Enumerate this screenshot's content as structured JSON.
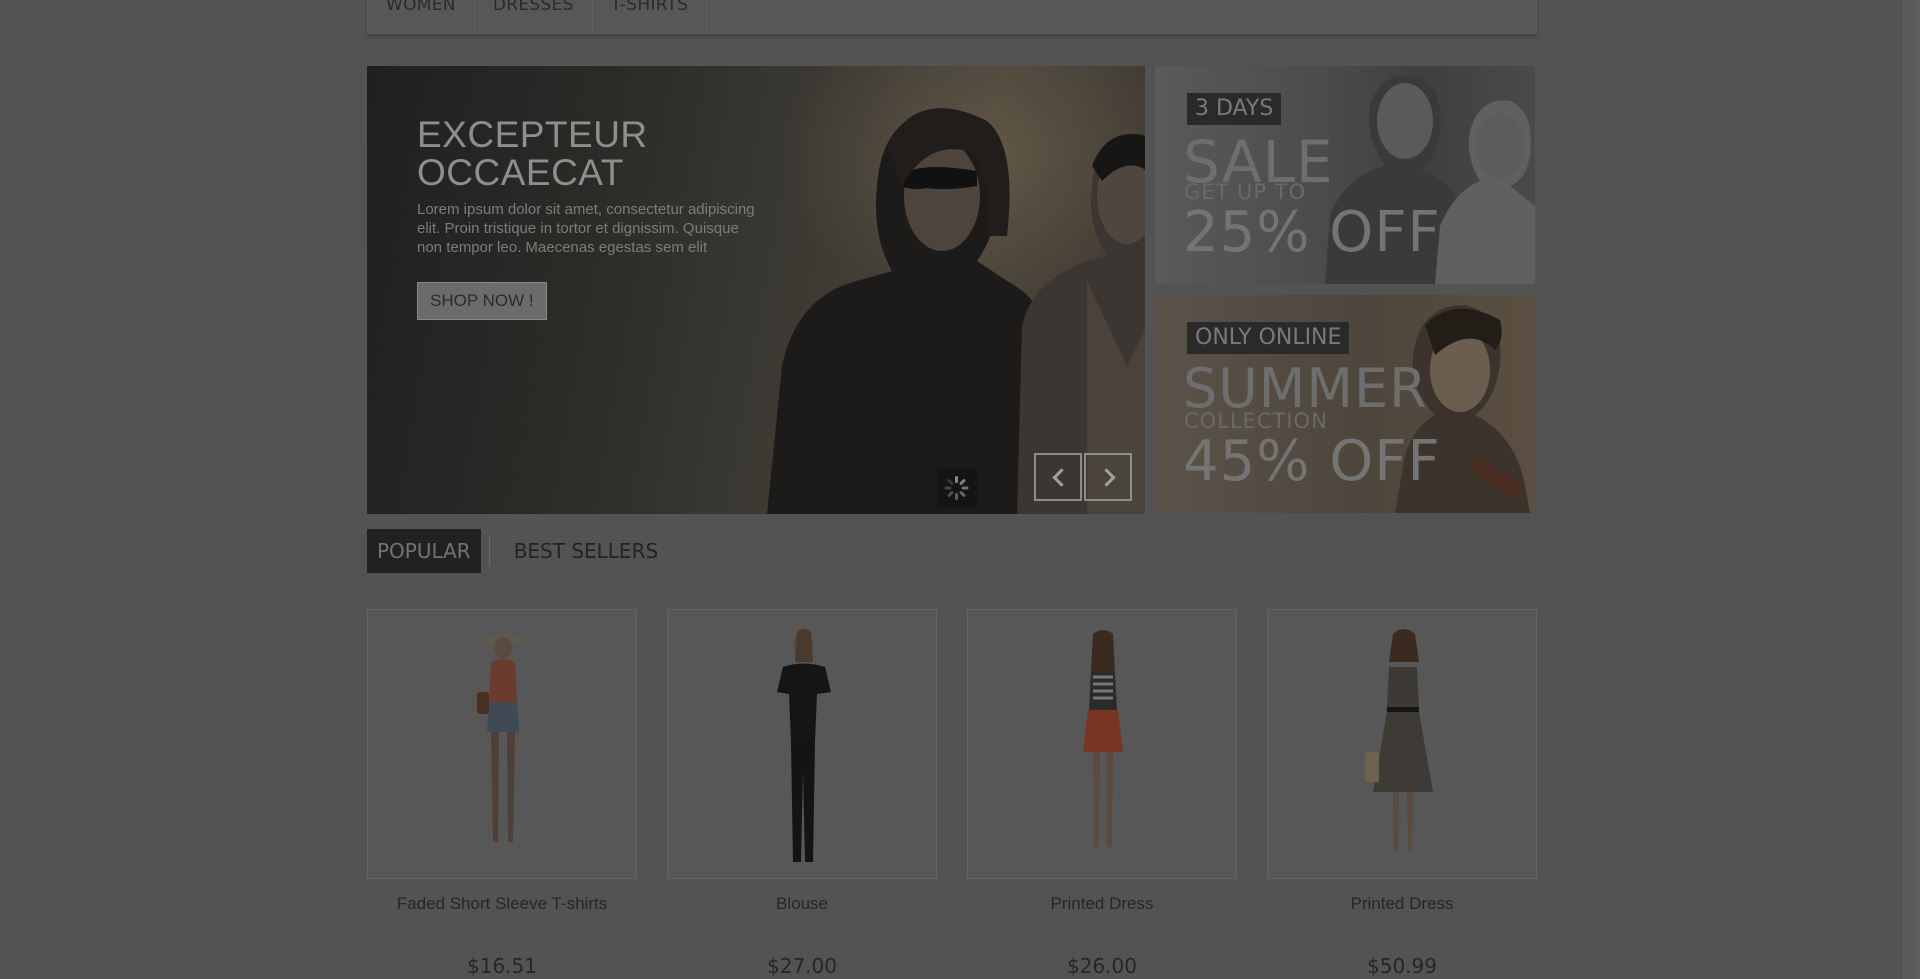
{
  "nav": {
    "items": [
      {
        "label": "WOMEN"
      },
      {
        "label": "DRESSES"
      },
      {
        "label": "T-SHIRTS"
      }
    ]
  },
  "slider": {
    "title": "EXCEPTEUR OCCAECAT",
    "text": "Lorem ipsum dolor sit amet, consectetur adipiscing elit. Proin tristique in tortor et dignissim. Quisque non tempor leo. Maecenas egestas sem elit",
    "button": "SHOP NOW !"
  },
  "promos": [
    {
      "tag": "3 DAYS",
      "big": "SALE",
      "sub": "GET UP TO",
      "off": "25% OFF"
    },
    {
      "tag": "ONLY ONLINE",
      "big": "SUMMER",
      "sub": "COLLECTION",
      "off": "45% OFF"
    }
  ],
  "tabs": [
    {
      "label": "POPULAR",
      "active": true
    },
    {
      "label": "BEST SELLERS",
      "active": false
    }
  ],
  "products": [
    {
      "name": "Faded Short Sleeve T-shirts",
      "price": "$16.51"
    },
    {
      "name": "Blouse",
      "price": "$27.00"
    },
    {
      "name": "Printed Dress",
      "price": "$26.00"
    },
    {
      "name": "Printed Dress",
      "price": "$50.99"
    }
  ],
  "colors": {
    "overlay_bg": "#535353",
    "active_tab_bg": "#212121"
  }
}
